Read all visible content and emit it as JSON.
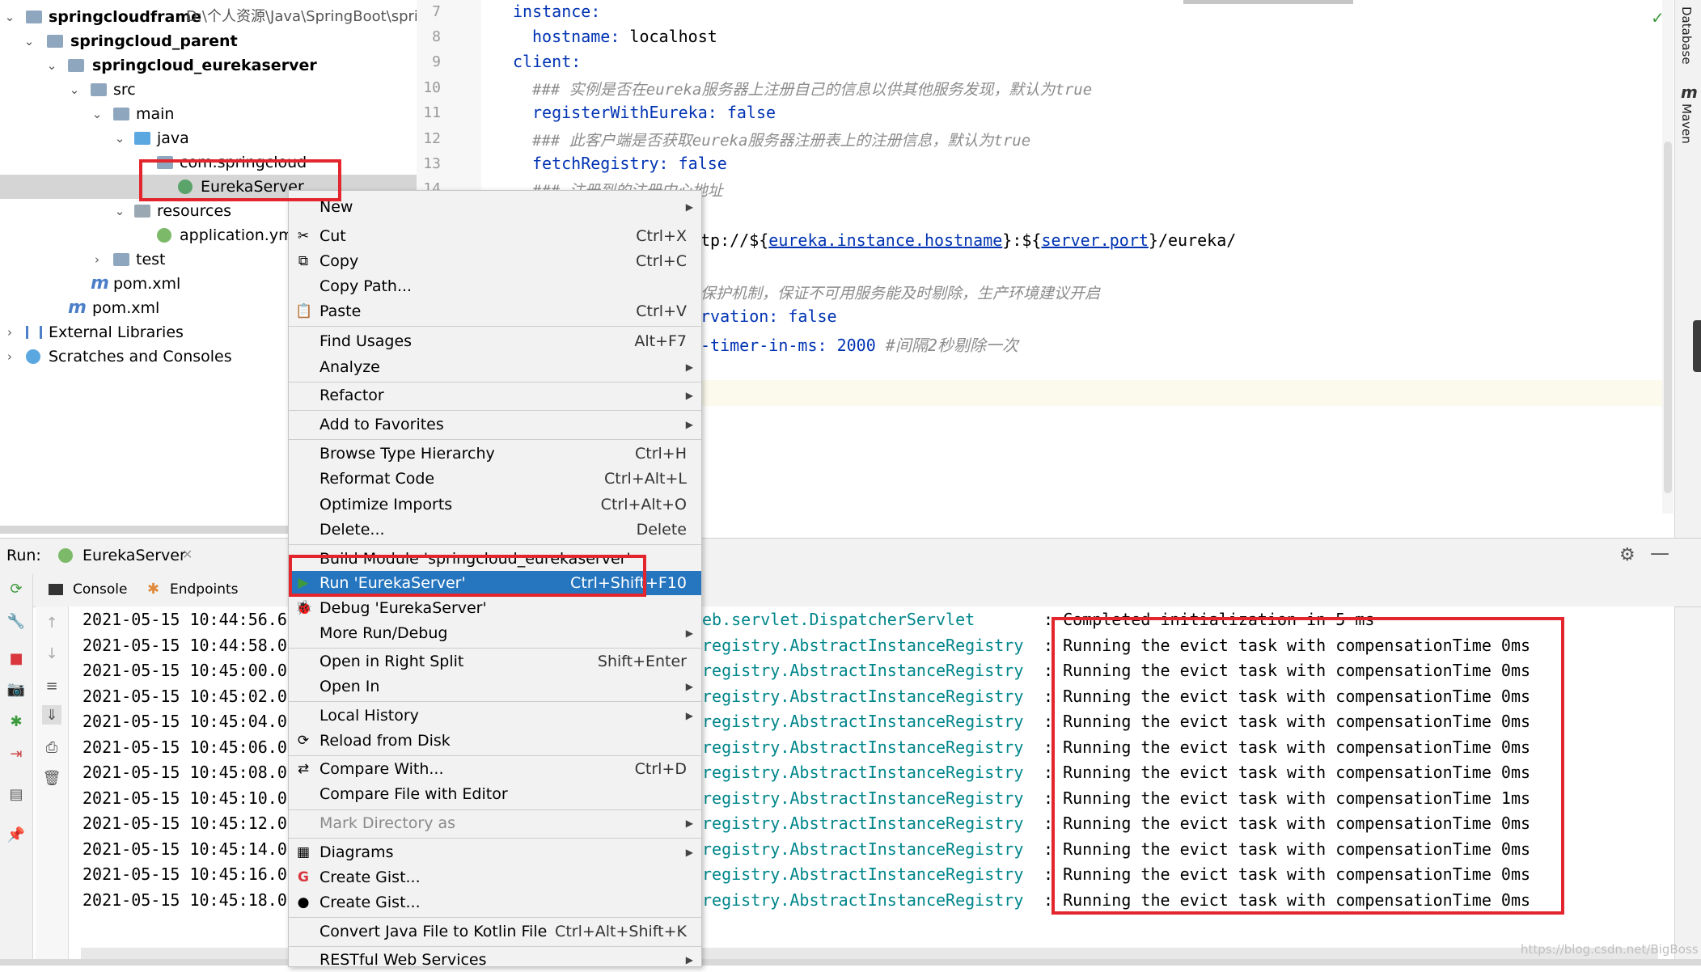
{
  "project_tree": [
    {
      "label": "springcloudframe",
      "path_hint": "D:\\个人资源\\Java\\SpringBoot\\spri",
      "bold": true
    },
    {
      "label": "springcloud_parent",
      "bold": true
    },
    {
      "label": "springcloud_eurekaserver",
      "bold": true
    },
    {
      "label": "src"
    },
    {
      "label": "main"
    },
    {
      "label": "java"
    },
    {
      "label": "com.springcloud"
    },
    {
      "label": "EurekaServer"
    },
    {
      "label": "resources"
    },
    {
      "label": "application.yml"
    },
    {
      "label": "test"
    },
    {
      "label": "pom.xml"
    },
    {
      "label": "pom.xml"
    },
    {
      "label": "External Libraries"
    },
    {
      "label": "Scratches and Consoles"
    }
  ],
  "editor": {
    "line_numbers": [
      "7",
      "8",
      "9",
      "10",
      "11",
      "12",
      "13",
      "14"
    ],
    "lines": [
      {
        "key": "instance:",
        "value": ""
      },
      {
        "key": "hostname:",
        "value": " localhost"
      },
      {
        "key": "client:",
        "value": ""
      },
      {
        "comment": "### 实例是否在eureka服务器上注册自己的信息以供其他服务发现，默认为true"
      },
      {
        "key": "registerWithEureka:",
        "value": " false"
      },
      {
        "comment": "### 此客户端是否获取eureka服务器注册表上的注册信息，默认为true"
      },
      {
        "key": "fetchRegistry:",
        "value": " false"
      },
      {
        "comment": "### 注册到的注册中心地址"
      }
    ],
    "url_prefix": "tp://${",
    "url_host": "eureka.instance.hostname",
    "url_mid": "}:${",
    "url_port": "server.port",
    "url_suffix": "}/eureka/",
    "comment2": "保护机制，保证不可用服务能及时剔除，生产环境建议开启",
    "ser_key": "rvation:",
    "ser_val": " false",
    "timer_key": "-timer-in-ms:",
    "timer_val": " 2000",
    "timer_comment": " #间隔2秒剔除一次"
  },
  "run_panel": {
    "run_label": "Run:",
    "run_tab": "EurekaServer",
    "console_tab": "Console",
    "endpoints_tab": "Endpoints",
    "timestamps": [
      "2021-05-15 10:44:56.6",
      "2021-05-15 10:44:58.0",
      "2021-05-15 10:45:00.0",
      "2021-05-15 10:45:02.0",
      "2021-05-15 10:45:04.0",
      "2021-05-15 10:45:06.0",
      "2021-05-15 10:45:08.0",
      "2021-05-15 10:45:10.0",
      "2021-05-15 10:45:12.0",
      "2021-05-15 10:45:14.0",
      "2021-05-15 10:45:16.0",
      "2021-05-15 10:45:18.0"
    ],
    "loggers": [
      "eb.servlet.DispatcherServlet",
      "registry.AbstractInstanceRegistry",
      "registry.AbstractInstanceRegistry",
      "registry.AbstractInstanceRegistry",
      "registry.AbstractInstanceRegistry",
      "registry.AbstractInstanceRegistry",
      "registry.AbstractInstanceRegistry",
      "registry.AbstractInstanceRegistry",
      "registry.AbstractInstanceRegistry",
      "registry.AbstractInstanceRegistry",
      "registry.AbstractInstanceRegistry",
      "registry.AbstractInstanceRegistry"
    ],
    "messages": [
      ": Completed initialization in 5 ms",
      ": Running the evict task with compensationTime 0ms",
      ": Running the evict task with compensationTime 0ms",
      ": Running the evict task with compensationTime 0ms",
      ": Running the evict task with compensationTime 0ms",
      ": Running the evict task with compensationTime 0ms",
      ": Running the evict task with compensationTime 0ms",
      ": Running the evict task with compensationTime 1ms",
      ": Running the evict task with compensationTime 0ms",
      ": Running the evict task with compensationTime 0ms",
      ": Running the evict task with compensationTime 0ms",
      ": Running the evict task with compensationTime 0ms"
    ]
  },
  "context_menu": [
    {
      "label": "New",
      "submenu": true
    },
    {
      "label": "Cut",
      "shortcut": "Ctrl+X",
      "icon": "✂"
    },
    {
      "label": "Copy",
      "shortcut": "Ctrl+C",
      "icon": "⧉"
    },
    {
      "label": "Copy Path...",
      "shortcut": ""
    },
    {
      "label": "Paste",
      "shortcut": "Ctrl+V",
      "icon": "📋"
    },
    {
      "label": "Find Usages",
      "shortcut": "Alt+F7"
    },
    {
      "label": "Analyze",
      "submenu": true
    },
    {
      "label": "Refactor",
      "submenu": true
    },
    {
      "label": "Add to Favorites",
      "submenu": true
    },
    {
      "label": "Browse Type Hierarchy",
      "shortcut": "Ctrl+H"
    },
    {
      "label": "Reformat Code",
      "shortcut": "Ctrl+Alt+L"
    },
    {
      "label": "Optimize Imports",
      "shortcut": "Ctrl+Alt+O"
    },
    {
      "label": "Delete...",
      "shortcut": "Delete"
    },
    {
      "label": "Build Module 'springcloud_eurekaserver'",
      "shortcut": ""
    },
    {
      "label": "Run 'EurekaServer'",
      "shortcut": "Ctrl+Shift+F10",
      "icon": "▶"
    },
    {
      "label": "Debug 'EurekaServer'",
      "shortcut": "",
      "icon": "🐞"
    },
    {
      "label": "More Run/Debug",
      "submenu": true
    },
    {
      "label": "Open in Right Split",
      "shortcut": "Shift+Enter"
    },
    {
      "label": "Open In",
      "submenu": true
    },
    {
      "label": "Local History",
      "submenu": true
    },
    {
      "label": "Reload from Disk",
      "shortcut": "",
      "icon": "⟳"
    },
    {
      "label": "Compare With...",
      "shortcut": "Ctrl+D",
      "icon": "⇄"
    },
    {
      "label": "Compare File with Editor",
      "shortcut": ""
    },
    {
      "label": "Mark Directory as",
      "submenu": true
    },
    {
      "label": "Diagrams",
      "submenu": true,
      "icon": "▦"
    },
    {
      "label": "Create Gist...",
      "shortcut": "",
      "icon": "G"
    },
    {
      "label": "Create Gist...",
      "shortcut": "",
      "icon": "●"
    },
    {
      "label": "Convert Java File to Kotlin File",
      "shortcut": "Ctrl+Alt+Shift+K"
    },
    {
      "label": "RESTful Web Services",
      "submenu": true
    }
  ],
  "right_strip": {
    "database": "Database",
    "maven": "Maven"
  },
  "watermark": "https://blog.csdn.net/BigBoss"
}
